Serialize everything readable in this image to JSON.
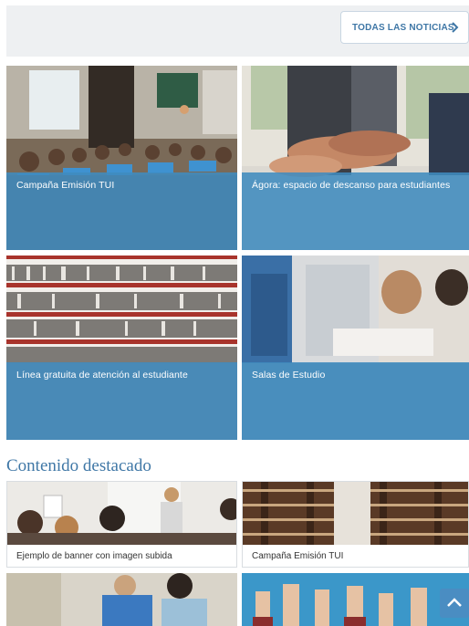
{
  "header": {
    "all_news_label": "TODAS LAS NOTICIAS",
    "all_news_icon": "chevron-right-icon"
  },
  "news_tiles": [
    {
      "title": "Campaña Emisión TUI"
    },
    {
      "title": "Ágora: espacio de descanso para estudiantes"
    },
    {
      "title": "Línea gratuita de atención al estudiante"
    },
    {
      "title": "Salas de Estudio"
    }
  ],
  "featured": {
    "title": "Contenido destacado",
    "cards": [
      {
        "caption": "Ejemplo de banner con imagen subida"
      },
      {
        "caption": "Campaña Emisión TUI"
      }
    ]
  },
  "back_to_top_icon": "chevron-up-icon",
  "colors": {
    "accent": "#3f77a6",
    "overlay": "#408bbe",
    "topband": "#eef0f2"
  }
}
